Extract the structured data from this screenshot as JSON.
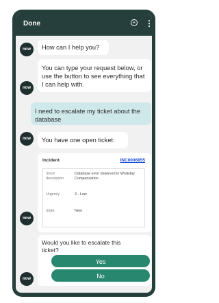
{
  "header": {
    "done_label": "Done",
    "plus_icon": "+",
    "menu_icon": "⋮"
  },
  "avatar_label": "now",
  "messages": [
    {
      "text": "How can I help you?"
    },
    {
      "text": "You can type your request below, or use the button to see everything that I can help with."
    },
    {
      "text": "I need to escalate my ticket about the database"
    },
    {
      "text": "You have one open ticket:"
    }
  ],
  "ticket": {
    "title": "Incident",
    "number": "INC0006855",
    "fields": [
      {
        "key": "Short description",
        "value": "Database error observed in Workday Compensation"
      },
      {
        "key": "Urgency",
        "value": "3 - Low"
      },
      {
        "key": "State",
        "value": "New"
      }
    ]
  },
  "escalate": {
    "question": "Would you like to escalate this ticket?",
    "yes_label": "Yes",
    "no_label": "No"
  }
}
